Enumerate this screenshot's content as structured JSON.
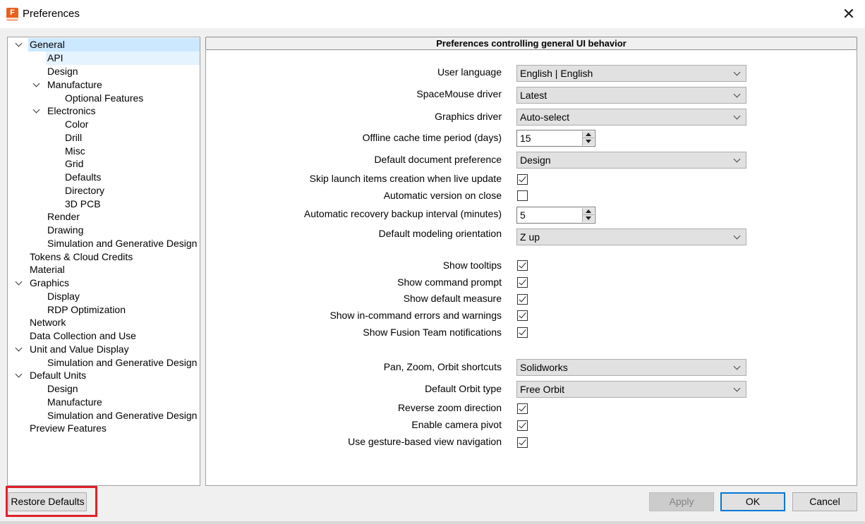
{
  "window": {
    "title": "Preferences",
    "app_icon_letter": "F"
  },
  "tree": {
    "items": [
      {
        "label": "General",
        "expanded": true,
        "state": "selected"
      },
      {
        "label": "API",
        "state": "hover"
      },
      {
        "label": "Design"
      },
      {
        "label": "Manufacture",
        "expanded": true
      },
      {
        "label": "Optional Features"
      },
      {
        "label": "Electronics",
        "expanded": true
      },
      {
        "label": "Color"
      },
      {
        "label": "Drill"
      },
      {
        "label": "Misc"
      },
      {
        "label": "Grid"
      },
      {
        "label": "Defaults"
      },
      {
        "label": "Directory"
      },
      {
        "label": "3D PCB"
      },
      {
        "label": "Render"
      },
      {
        "label": "Drawing"
      },
      {
        "label": "Simulation and Generative Design"
      },
      {
        "label": "Tokens & Cloud Credits"
      },
      {
        "label": "Material"
      },
      {
        "label": "Graphics",
        "expanded": true
      },
      {
        "label": "Display"
      },
      {
        "label": "RDP Optimization"
      },
      {
        "label": "Network"
      },
      {
        "label": "Data Collection and Use"
      },
      {
        "label": "Unit and Value Display",
        "expanded": true
      },
      {
        "label": "Simulation and Generative Design"
      },
      {
        "label": "Default Units",
        "expanded": true
      },
      {
        "label": "Design"
      },
      {
        "label": "Manufacture"
      },
      {
        "label": "Simulation and Generative Design"
      },
      {
        "label": "Preview Features"
      }
    ]
  },
  "panel": {
    "header": "Preferences controlling general UI behavior",
    "user_language": {
      "label": "User language",
      "value": "English | English"
    },
    "spacemouse_driver": {
      "label": "SpaceMouse driver",
      "value": "Latest"
    },
    "graphics_driver": {
      "label": "Graphics driver",
      "value": "Auto-select"
    },
    "offline_cache": {
      "label": "Offline cache time period (days)",
      "value": "15"
    },
    "default_document": {
      "label": "Default document preference",
      "value": "Design"
    },
    "skip_launch": {
      "label": "Skip launch items creation when live update",
      "checked": true
    },
    "auto_version": {
      "label": "Automatic version on close",
      "checked": false
    },
    "recovery_interval": {
      "label": "Automatic recovery backup interval (minutes)",
      "value": "5"
    },
    "modeling_orientation": {
      "label": "Default modeling orientation",
      "value": "Z up"
    },
    "show_tooltips": {
      "label": "Show tooltips",
      "checked": true
    },
    "show_command_prompt": {
      "label": "Show command prompt",
      "checked": true
    },
    "show_default_measure": {
      "label": "Show default measure",
      "checked": true
    },
    "show_errors": {
      "label": "Show in-command errors and warnings",
      "checked": true
    },
    "show_team_notifications": {
      "label": "Show Fusion Team notifications",
      "checked": true
    },
    "pzo_shortcuts": {
      "label": "Pan, Zoom, Orbit shortcuts",
      "value": "Solidworks"
    },
    "default_orbit": {
      "label": "Default Orbit type",
      "value": "Free Orbit"
    },
    "reverse_zoom": {
      "label": "Reverse zoom direction",
      "checked": true
    },
    "camera_pivot": {
      "label": "Enable camera pivot",
      "checked": true
    },
    "gesture_nav": {
      "label": "Use gesture-based view navigation",
      "checked": true
    }
  },
  "buttons": {
    "restore_defaults": "Restore Defaults",
    "apply": "Apply",
    "ok": "OK",
    "cancel": "Cancel"
  },
  "colors": {
    "selected_bg": "#cce8ff",
    "hover_bg": "#e5f3ff",
    "focus_border": "#0078d7",
    "annotation_red": "#e0202a",
    "app_icon": "#e8601c"
  }
}
